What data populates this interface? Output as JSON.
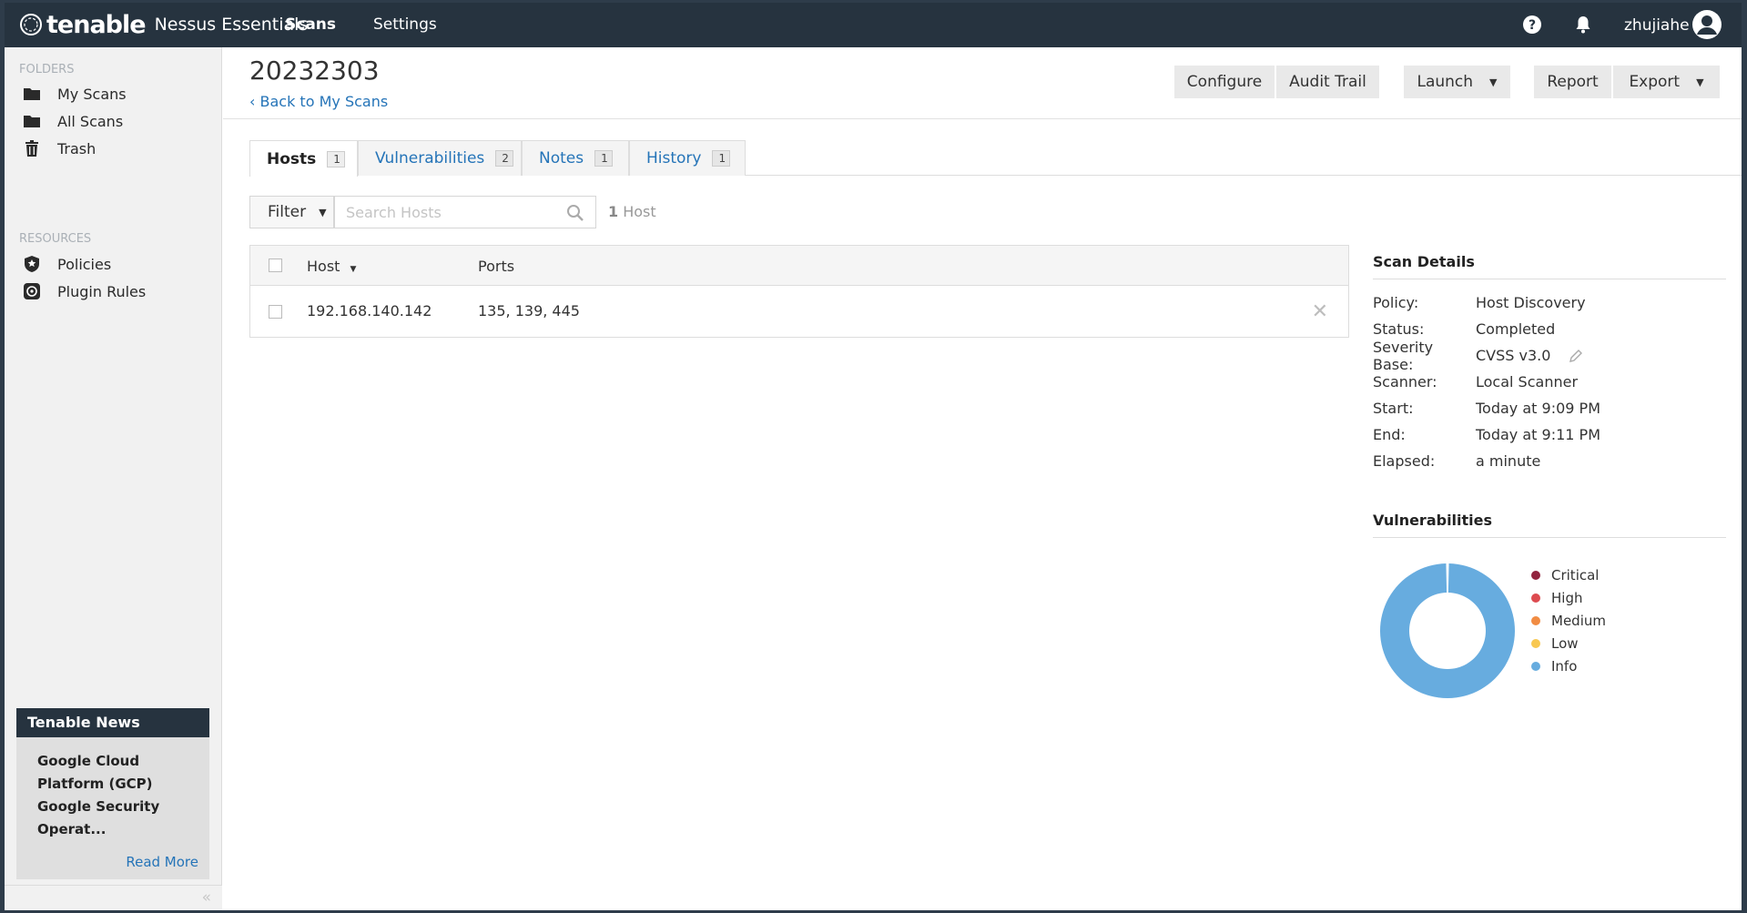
{
  "topbar": {
    "brand": "tenable",
    "product": "Nessus Essentials",
    "nav": {
      "scans": "Scans",
      "settings": "Settings"
    },
    "username": "zhujiahe"
  },
  "sidebar": {
    "folders_heading": "FOLDERS",
    "folders": [
      {
        "label": "My Scans",
        "icon": "folder-icon"
      },
      {
        "label": "All Scans",
        "icon": "folder-icon"
      },
      {
        "label": "Trash",
        "icon": "trash-icon"
      }
    ],
    "resources_heading": "RESOURCES",
    "resources": [
      {
        "label": "Policies",
        "icon": "policy-badge-icon"
      },
      {
        "label": "Plugin Rules",
        "icon": "plugin-rules-icon"
      }
    ],
    "news": {
      "title": "Tenable News",
      "lines": [
        "Google Cloud",
        "Platform (GCP)",
        "Google Security",
        "Operat..."
      ],
      "read_more": "Read More"
    }
  },
  "header": {
    "title": "20232303",
    "back_link": "Back to My Scans",
    "buttons": {
      "configure": "Configure",
      "audit_trail": "Audit Trail",
      "launch": "Launch",
      "report": "Report",
      "export": "Export"
    }
  },
  "tabs": [
    {
      "label": "Hosts",
      "count": "1",
      "active": true
    },
    {
      "label": "Vulnerabilities",
      "count": "2",
      "active": false
    },
    {
      "label": "Notes",
      "count": "1",
      "active": false
    },
    {
      "label": "History",
      "count": "1",
      "active": false
    }
  ],
  "filter": {
    "label": "Filter",
    "search_placeholder": "Search Hosts",
    "host_count_num": "1",
    "host_count_label": "Host"
  },
  "table": {
    "columns": {
      "host": "Host",
      "ports": "Ports"
    },
    "rows": [
      {
        "host": "192.168.140.142",
        "ports": "135, 139, 445"
      }
    ]
  },
  "scan_details": {
    "title": "Scan Details",
    "fields": [
      {
        "key": "Policy:",
        "value": "Host Discovery"
      },
      {
        "key": "Status:",
        "value": "Completed"
      },
      {
        "key": "Severity Base:",
        "value": "CVSS v3.0"
      },
      {
        "key": "Scanner:",
        "value": "Local Scanner"
      },
      {
        "key": "Start:",
        "value": "Today at 9:09 PM"
      },
      {
        "key": "End:",
        "value": "Today at 9:11 PM"
      },
      {
        "key": "Elapsed:",
        "value": "a minute"
      }
    ]
  },
  "vulnerabilities": {
    "title": "Vulnerabilities",
    "legend": [
      {
        "label": "Critical",
        "color": "#91243e",
        "count": 0
      },
      {
        "label": "High",
        "color": "#dd4b50",
        "count": 0
      },
      {
        "label": "Medium",
        "color": "#f18c43",
        "count": 0
      },
      {
        "label": "Low",
        "color": "#f8c851",
        "count": 0
      },
      {
        "label": "Info",
        "color": "#67acdf",
        "count": 2
      }
    ]
  },
  "colors": {
    "topbar": "#26333f",
    "link": "#2574b8",
    "info": "#67acdf"
  }
}
